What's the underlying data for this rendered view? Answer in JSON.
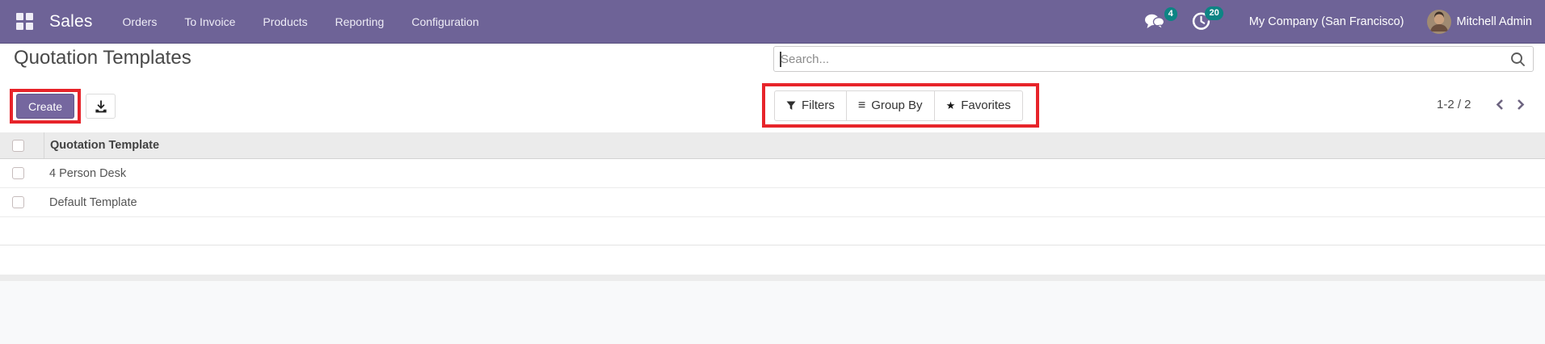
{
  "colors": {
    "navbar_bg": "#6e6397",
    "badge_bg": "#0d8484",
    "create_bg": "#75679f",
    "annotation_red": "#e7242a",
    "footer_bg": "#f8f9fa"
  },
  "navbar": {
    "brand": "Sales",
    "menu_items": [
      "Orders",
      "To Invoice",
      "Products",
      "Reporting",
      "Configuration"
    ],
    "messages_badge": "4",
    "activities_badge": "20",
    "company": "My Company (San Francisco)",
    "user": "Mitchell Admin"
  },
  "content": {
    "page_title": "Quotation Templates",
    "create_label": "Create",
    "search": {
      "placeholder": "Search...",
      "value": ""
    },
    "filter_buttons": [
      {
        "icon": "filter-icon",
        "label": "Filters"
      },
      {
        "icon": "group-by-icon",
        "label": "Group By"
      },
      {
        "icon": "star-icon",
        "label": "Favorites"
      }
    ],
    "icons": {
      "group_by": "≡",
      "favorites": "★"
    },
    "pagination": {
      "range": "1-2 / 2"
    },
    "table": {
      "columns": [
        "Quotation Template"
      ],
      "rows": [
        {
          "name": "4 Person Desk"
        },
        {
          "name": "Default Template"
        }
      ]
    }
  }
}
